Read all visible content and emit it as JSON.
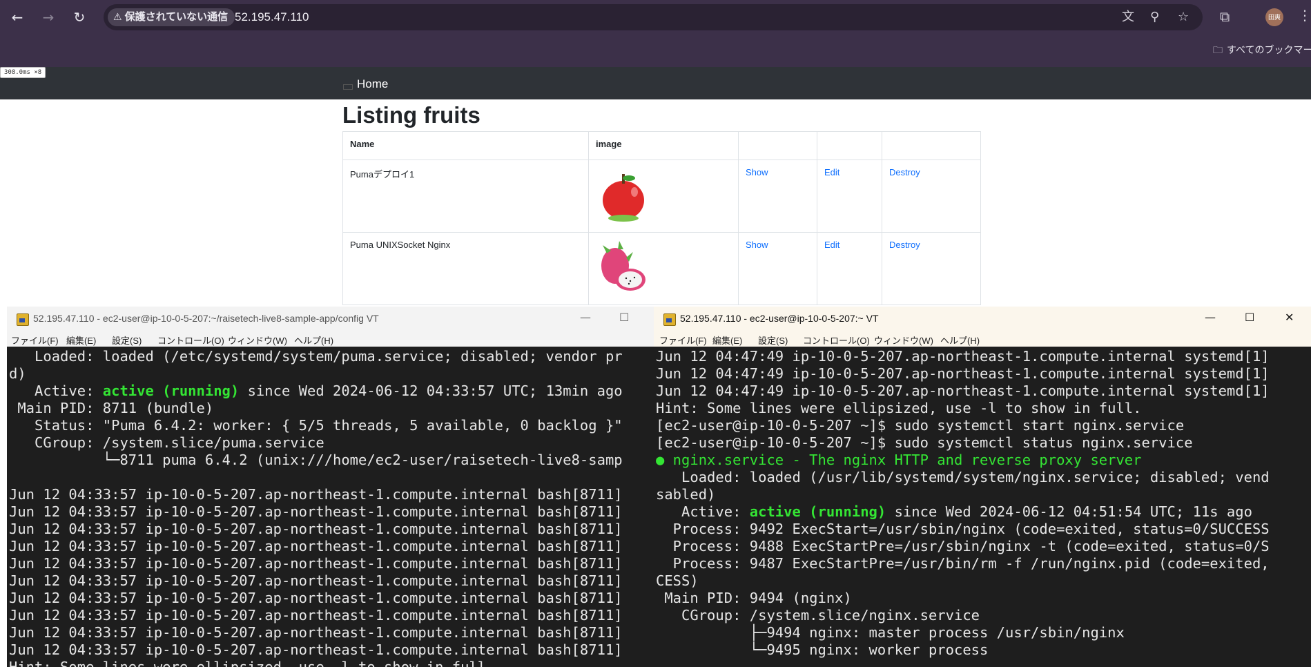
{
  "browser": {
    "security_label": "保護されていない通信",
    "url": "52.195.47.110",
    "avatar": "田爽",
    "bookmarks_label": "すべてのブックマーク"
  },
  "page": {
    "timing": "308.0ms ×8",
    "nav_home": "Home",
    "title": "Listing fruits",
    "table": {
      "headers": [
        "Name",
        "image",
        "",
        "",
        ""
      ],
      "rows": [
        {
          "name": "Pumaデプロイ1",
          "image": "apple",
          "show": "Show",
          "edit": "Edit",
          "destroy": "Destroy"
        },
        {
          "name": "Puma UNIXSocket Nginx",
          "image": "dragon-fruit",
          "show": "Show",
          "edit": "Edit",
          "destroy": "Destroy"
        }
      ]
    }
  },
  "terminal_left": {
    "title": "52.195.47.110 - ec2-user@ip-10-0-5-207:~/raisetech-live8-sample-app/config VT",
    "menu": [
      "ファイル(F)",
      "編集(E)",
      "設定(S)",
      "コントロール(O)",
      "ウィンドウ(W)",
      "ヘルプ(H)"
    ],
    "lines": [
      "   Loaded: loaded (/etc/systemd/system/puma.service; disabled; vendor pr",
      "d)",
      "   Active: ",
      " Main PID: 8711 (bundle)",
      "   Status: \"Puma 6.4.2: worker: { 5/5 threads, 5 available, 0 backlog }\"",
      "   CGroup: /system.slice/puma.service",
      "           └─8711 puma 6.4.2 (unix:///home/ec2-user/raisetech-live8-samp",
      "",
      "Jun 12 04:33:57 ip-10-0-5-207.ap-northeast-1.compute.internal bash[8711]",
      "Jun 12 04:33:57 ip-10-0-5-207.ap-northeast-1.compute.internal bash[8711]",
      "Jun 12 04:33:57 ip-10-0-5-207.ap-northeast-1.compute.internal bash[8711]",
      "Jun 12 04:33:57 ip-10-0-5-207.ap-northeast-1.compute.internal bash[8711]",
      "Jun 12 04:33:57 ip-10-0-5-207.ap-northeast-1.compute.internal bash[8711]",
      "Jun 12 04:33:57 ip-10-0-5-207.ap-northeast-1.compute.internal bash[8711]",
      "Jun 12 04:33:57 ip-10-0-5-207.ap-northeast-1.compute.internal bash[8711]",
      "Jun 12 04:33:57 ip-10-0-5-207.ap-northeast-1.compute.internal bash[8711]",
      "Jun 12 04:33:57 ip-10-0-5-207.ap-northeast-1.compute.internal bash[8711]",
      "Jun 12 04:33:57 ip-10-0-5-207.ap-northeast-1.compute.internal bash[8711]",
      "Hint: Some lines were ellipsized, use -l to show in full."
    ],
    "active_state": "active (running)",
    "active_rest": " since Wed 2024-06-12 04:33:57 UTC; 13min ago"
  },
  "terminal_right": {
    "title": "52.195.47.110 - ec2-user@ip-10-0-5-207:~ VT",
    "menu": [
      "ファイル(F)",
      "編集(E)",
      "設定(S)",
      "コントロール(O)",
      "ウィンドウ(W)",
      "ヘルプ(H)"
    ],
    "lines": [
      "Jun 12 04:47:49 ip-10-0-5-207.ap-northeast-1.compute.internal systemd[1]",
      "Jun 12 04:47:49 ip-10-0-5-207.ap-northeast-1.compute.internal systemd[1]",
      "Jun 12 04:47:49 ip-10-0-5-207.ap-northeast-1.compute.internal systemd[1]",
      "Hint: Some lines were ellipsized, use -l to show in full.",
      "[ec2-user@ip-10-0-5-207 ~]$ sudo systemctl start nginx.service",
      "[ec2-user@ip-10-0-5-207 ~]$ sudo systemctl status nginx.service",
      "● nginx.service - The nginx HTTP and reverse proxy server",
      "   Loaded: loaded (/usr/lib/systemd/system/nginx.service; disabled; vend",
      "sabled)",
      "   Active: ",
      "  Process: 9492 ExecStart=/usr/sbin/nginx (code=exited, status=0/SUCCESS",
      "  Process: 9488 ExecStartPre=/usr/sbin/nginx -t (code=exited, status=0/S",
      "  Process: 9487 ExecStartPre=/usr/bin/rm -f /run/nginx.pid (code=exited,",
      "CESS)",
      " Main PID: 9494 (nginx)",
      "   CGroup: /system.slice/nginx.service",
      "           ├─9494 nginx: master process /usr/sbin/nginx",
      "           └─9495 nginx: worker process"
    ],
    "active_state": "active (running)",
    "active_rest": " since Wed 2024-06-12 04:51:54 UTC; 11s ago"
  }
}
